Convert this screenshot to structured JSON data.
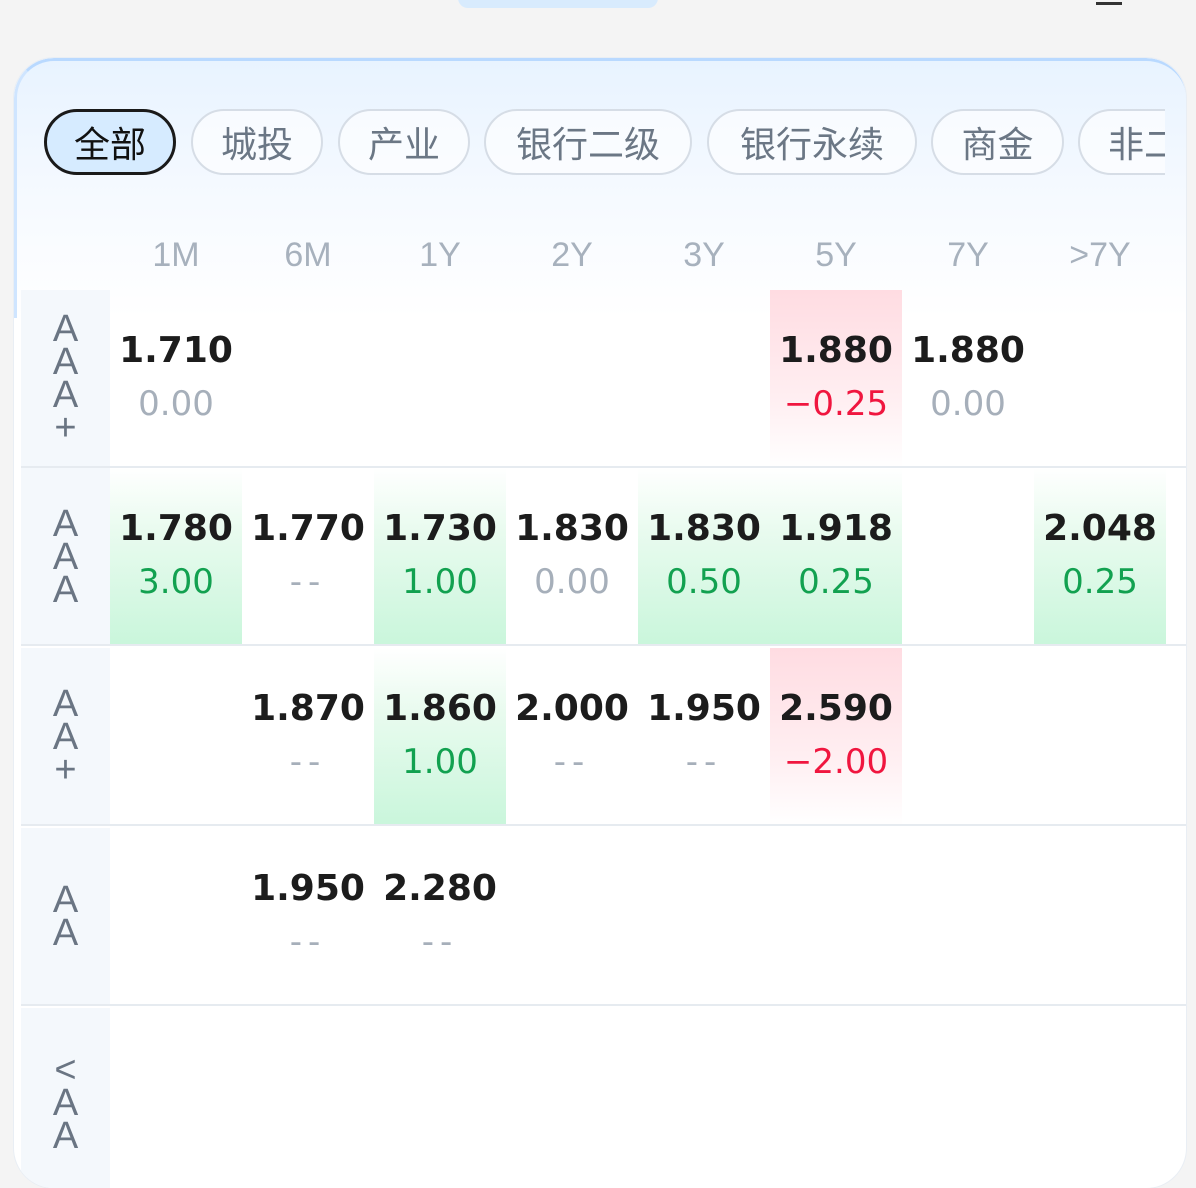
{
  "filters": [
    "全部",
    "城投",
    "产业",
    "银行二级",
    "银行永续",
    "商金",
    "非二"
  ],
  "active_filter": "全部",
  "columns": [
    "1M",
    "6M",
    "1Y",
    "2Y",
    "3Y",
    "5Y",
    "7Y",
    ">7Y"
  ],
  "rows": [
    {
      "rating_chars": [
        "A",
        "A",
        "A",
        "+"
      ],
      "cells": [
        {
          "col": 0,
          "value": "1.710",
          "change": "0.00",
          "trend": "flat"
        },
        {
          "col": 5,
          "value": "1.880",
          "change": "−0.25",
          "trend": "down"
        },
        {
          "col": 6,
          "value": "1.880",
          "change": "0.00",
          "trend": "flat"
        }
      ]
    },
    {
      "rating_chars": [
        "A",
        "A",
        "A"
      ],
      "cells": [
        {
          "col": 0,
          "value": "1.780",
          "change": "3.00",
          "trend": "up"
        },
        {
          "col": 1,
          "value": "1.770",
          "change": "--",
          "trend": "none"
        },
        {
          "col": 2,
          "value": "1.730",
          "change": "1.00",
          "trend": "up"
        },
        {
          "col": 3,
          "value": "1.830",
          "change": "0.00",
          "trend": "flat"
        },
        {
          "col": 4,
          "value": "1.830",
          "change": "0.50",
          "trend": "up"
        },
        {
          "col": 5,
          "value": "1.918",
          "change": "0.25",
          "trend": "up"
        },
        {
          "col": 7,
          "value": "2.048",
          "change": "0.25",
          "trend": "up"
        }
      ]
    },
    {
      "rating_chars": [
        "A",
        "A",
        "+"
      ],
      "cells": [
        {
          "col": 1,
          "value": "1.870",
          "change": "--",
          "trend": "none"
        },
        {
          "col": 2,
          "value": "1.860",
          "change": "1.00",
          "trend": "up"
        },
        {
          "col": 3,
          "value": "2.000",
          "change": "--",
          "trend": "none"
        },
        {
          "col": 4,
          "value": "1.950",
          "change": "--",
          "trend": "none"
        },
        {
          "col": 5,
          "value": "2.590",
          "change": "−2.00",
          "trend": "down"
        }
      ]
    },
    {
      "rating_chars": [
        "A",
        "A"
      ],
      "cells": [
        {
          "col": 1,
          "value": "1.950",
          "change": "--",
          "trend": "none"
        },
        {
          "col": 2,
          "value": "2.280",
          "change": "--",
          "trend": "none"
        }
      ]
    },
    {
      "rating_chars": [
        "<",
        "A",
        "A"
      ],
      "cells": []
    }
  ],
  "colors": {
    "up": "#12a150",
    "down": "#f0163f",
    "neutral": "#a6afba",
    "active_chip_bg": "#d6ebff"
  }
}
